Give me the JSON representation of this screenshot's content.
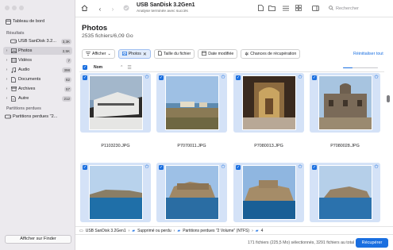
{
  "sidebar": {
    "dashboard_label": "Tableau de bord",
    "results_header": "Résultats",
    "items": [
      {
        "label": "USB  SanDisk 3.2...",
        "count": "3,3K",
        "icon": "drive-icon",
        "chevron": false,
        "selected": false
      },
      {
        "label": "Photos",
        "count": "2,5K",
        "icon": "photo-icon",
        "chevron": true,
        "selected": true
      },
      {
        "label": "Vidéos",
        "count": "7",
        "icon": "film-icon",
        "chevron": true,
        "selected": false
      },
      {
        "label": "Audio",
        "count": "398",
        "icon": "music-note-icon",
        "chevron": true,
        "selected": false
      },
      {
        "label": "Documents",
        "count": "82",
        "icon": "document-icon",
        "chevron": true,
        "selected": false
      },
      {
        "label": "Archives",
        "count": "57",
        "icon": "archive-icon",
        "chevron": true,
        "selected": false
      },
      {
        "label": "Autre",
        "count": "212",
        "icon": "file-icon",
        "chevron": true,
        "selected": false
      }
    ],
    "lost_header": "Partitions perdues",
    "lost_item": "Partitions perdues \"2...",
    "finder_button": "Afficher sur Finder"
  },
  "toolbar": {
    "title": "USB  SanDisk 3.2Gen1",
    "subtitle": "Analyse terminée avec succès",
    "search_placeholder": "Rechercher"
  },
  "main": {
    "title": "Photos",
    "subtitle": "2535 fichiers/6,09 Go",
    "filters": {
      "show": "Afficher",
      "photos": "Photos",
      "size": "Taille du fichier",
      "date": "Date modifiée",
      "chances": "Chances de récupération"
    },
    "reset": "Réinitialiser tout",
    "sort_column": "Nom"
  },
  "files": [
    {
      "name": "P1103230.JPG"
    },
    {
      "name": "P7070011.JPG"
    },
    {
      "name": "P7080013.JPG"
    },
    {
      "name": "P7080028.JPG"
    },
    {
      "name": ""
    },
    {
      "name": ""
    },
    {
      "name": ""
    },
    {
      "name": ""
    }
  ],
  "path": {
    "device": "USB  SanDisk 3.2Gen1",
    "p1": "Supprimé ou perdu",
    "p2": "Partitions perdues \"2 Volume\" (NTFS)",
    "p3": "4"
  },
  "footer": {
    "status": "171 fichiers (225,5 Mo) sélectionnés, 3291 fichiers au total",
    "recover_button": "Récupérer"
  },
  "colors": {
    "accent": "#1a6fe0",
    "sidebar_bg": "#eceaee",
    "selection_bg": "#d4e2f7"
  }
}
